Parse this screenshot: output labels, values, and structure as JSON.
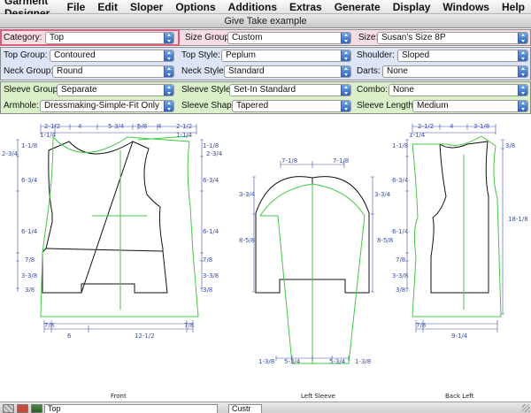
{
  "menubar": {
    "app_name": "Garment Designer",
    "items": [
      "File",
      "Edit",
      "Sloper",
      "Options",
      "Additions",
      "Extras",
      "Generate",
      "Display",
      "Windows",
      "Help"
    ]
  },
  "window": {
    "title": "Give Take example"
  },
  "options": {
    "category": {
      "label": "Category:",
      "value": "Top"
    },
    "size_group": {
      "label": "Size Group:",
      "value": "Custom"
    },
    "size": {
      "label": "Size:",
      "value": "Susan's Size 8P"
    },
    "top_group": {
      "label": "Top Group:",
      "value": "Contoured"
    },
    "top_style": {
      "label": "Top Style:",
      "value": "Peplum"
    },
    "shoulder": {
      "label": "Shoulder:",
      "value": "Sloped"
    },
    "neck_group": {
      "label": "Neck Group:",
      "value": "Round"
    },
    "neck_style": {
      "label": "Neck Style:",
      "value": "Standard"
    },
    "darts": {
      "label": "Darts:",
      "value": "None"
    },
    "sleeve_group": {
      "label": "Sleeve Group:",
      "value": "Separate"
    },
    "sleeve_style": {
      "label": "Sleeve Style:",
      "value": "Set-In Standard"
    },
    "combo": {
      "label": "Combo:",
      "value": "None"
    },
    "armhole": {
      "label": "Armhole:",
      "value": "Dressmaking-Simple-Fit Only"
    },
    "sleeve_shape": {
      "label": "Sleeve Shape:",
      "value": "Tapered"
    },
    "sleeve_length": {
      "label": "Sleeve Length:",
      "value": "Medium"
    }
  },
  "drawing": {
    "pieces": {
      "front": "Front",
      "left_sleeve": "Left Sleeve",
      "back_left": "Back Left"
    },
    "front_dims": {
      "top_a": "2-1/2",
      "top_b": "4",
      "top_c": "5-3/4",
      "top_d": "5/8",
      "top_e": "4",
      "top_f": "2-1/2",
      "top_g": "1-1/4",
      "top_h": "1-1/4",
      "left_1": "1-1/8",
      "left_2": "2-3/4",
      "left_3": "6-3/4",
      "left_4": "6-1/4",
      "left_5": "7/8",
      "left_6": "3-3/8",
      "left_7": "3/8",
      "right_1": "1-1/8",
      "right_2": "2-3/4",
      "right_3": "6-3/4",
      "right_4": "6-1/4",
      "right_5": "7/8",
      "right_6": "3-3/8",
      "right_7": "3/8",
      "bottom_a": "7/8",
      "bottom_b": "7/8",
      "bottom_c": "6",
      "bottom_d": "12-1/2"
    },
    "sleeve_dims": {
      "top_a": "7-1/8",
      "top_b": "7-1/8",
      "left_1": "3-3/4",
      "left_2": "8-5/8",
      "right_1": "3-3/4",
      "right_2": "8-5/8",
      "bottom_a": "1-3/8",
      "bottom_b": "5-3/4",
      "bottom_c": "5-3/4",
      "bottom_d": "1-3/8"
    },
    "back_dims": {
      "top_a": "2-1/2",
      "top_b": "4",
      "top_c": "3-1/8",
      "top_d": "1-1/4",
      "left_1": "1-1/8",
      "left_2": "6-3/4",
      "left_3": "6-1/4",
      "left_4": "7/8",
      "left_5": "3-3/8",
      "left_6": "3/8",
      "right_1": "3/8",
      "right_2": "18-1/8",
      "bottom_a": "7/8",
      "bottom_b": "9-1/4"
    }
  },
  "statusbar": {
    "field_left": "Top",
    "field_right": "Custr"
  },
  "colors": {
    "pattern_line": "#111111",
    "seam_line": "#44c944",
    "dimension": "#3a4fb0",
    "category_highlight": "#e05a7a"
  }
}
